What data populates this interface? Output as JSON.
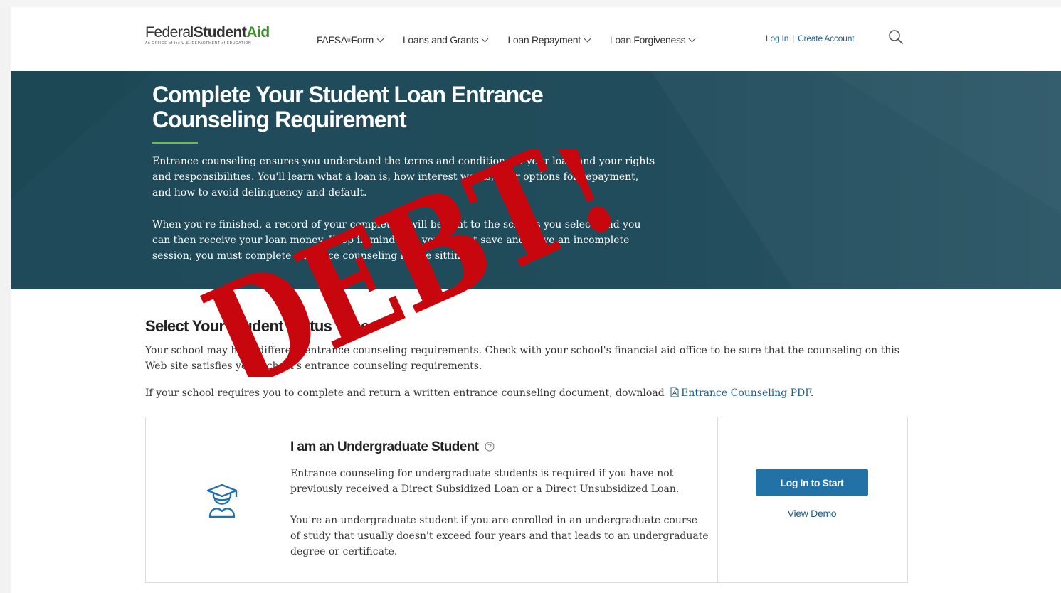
{
  "header": {
    "logo": {
      "prefix": "Federal",
      "middle": "Student",
      "suffix": "Aid",
      "tagline": "An OFFICE of the U.S. DEPARTMENT of EDUCATION"
    },
    "nav": [
      {
        "label": "FAFSA",
        "sup": "®",
        "suffix": " Form"
      },
      {
        "label": "Loans and Grants",
        "sup": "",
        "suffix": ""
      },
      {
        "label": "Loan Repayment",
        "sup": "",
        "suffix": ""
      },
      {
        "label": "Loan Forgiveness",
        "sup": "",
        "suffix": ""
      }
    ],
    "login": "Log In",
    "separator": "|",
    "create_account": "Create Account"
  },
  "hero": {
    "title": "Complete Your Student Loan Entrance Counseling Requirement",
    "paragraph1": "Entrance counseling ensures you understand the terms and conditions of your loan and your rights and responsibilities. You'll learn what a loan is, how interest works, your options for repayment, and how to avoid delinquency and default.",
    "paragraph2": "When you're finished, a record of your completion will be sent to the schools you select, and you can then receive your loan money. Keep in mind that you cannot save and leave an incomplete session; you must complete entrance counseling in one sitting."
  },
  "stamp": {
    "text": "DEBT!"
  },
  "content": {
    "section_title": "Select Your Student Status Type",
    "section_text": "Your school may have different entrance counseling requirements. Check with your school's financial aid office to be sure that the counseling on this Web site satisfies your school's entrance counseling requirements.",
    "pdf_intro": "If your school requires you to complete and return a written entrance counseling document, download",
    "pdf_link": "Entrance Counseling PDF",
    "pdf_end": "."
  },
  "card": {
    "title": "I am an Undergraduate Student",
    "text1": "Entrance counseling for undergraduate students is required if you have not previously received a Direct Subsidized Loan or a Direct Unsubsidized Loan.",
    "text2": "You're an undergraduate student if you are enrolled in an undergraduate course of study that usually doesn't exceed four years and that leads to an undergraduate degree or certificate.",
    "start_button": "Log In to Start",
    "demo_link": "View Demo"
  },
  "colors": {
    "hero_bg": "#1f4656",
    "accent_green": "#6cc04a",
    "link_blue": "#1f5f8b",
    "button_blue": "#2372a7",
    "stamp_red": "#c8060e"
  }
}
